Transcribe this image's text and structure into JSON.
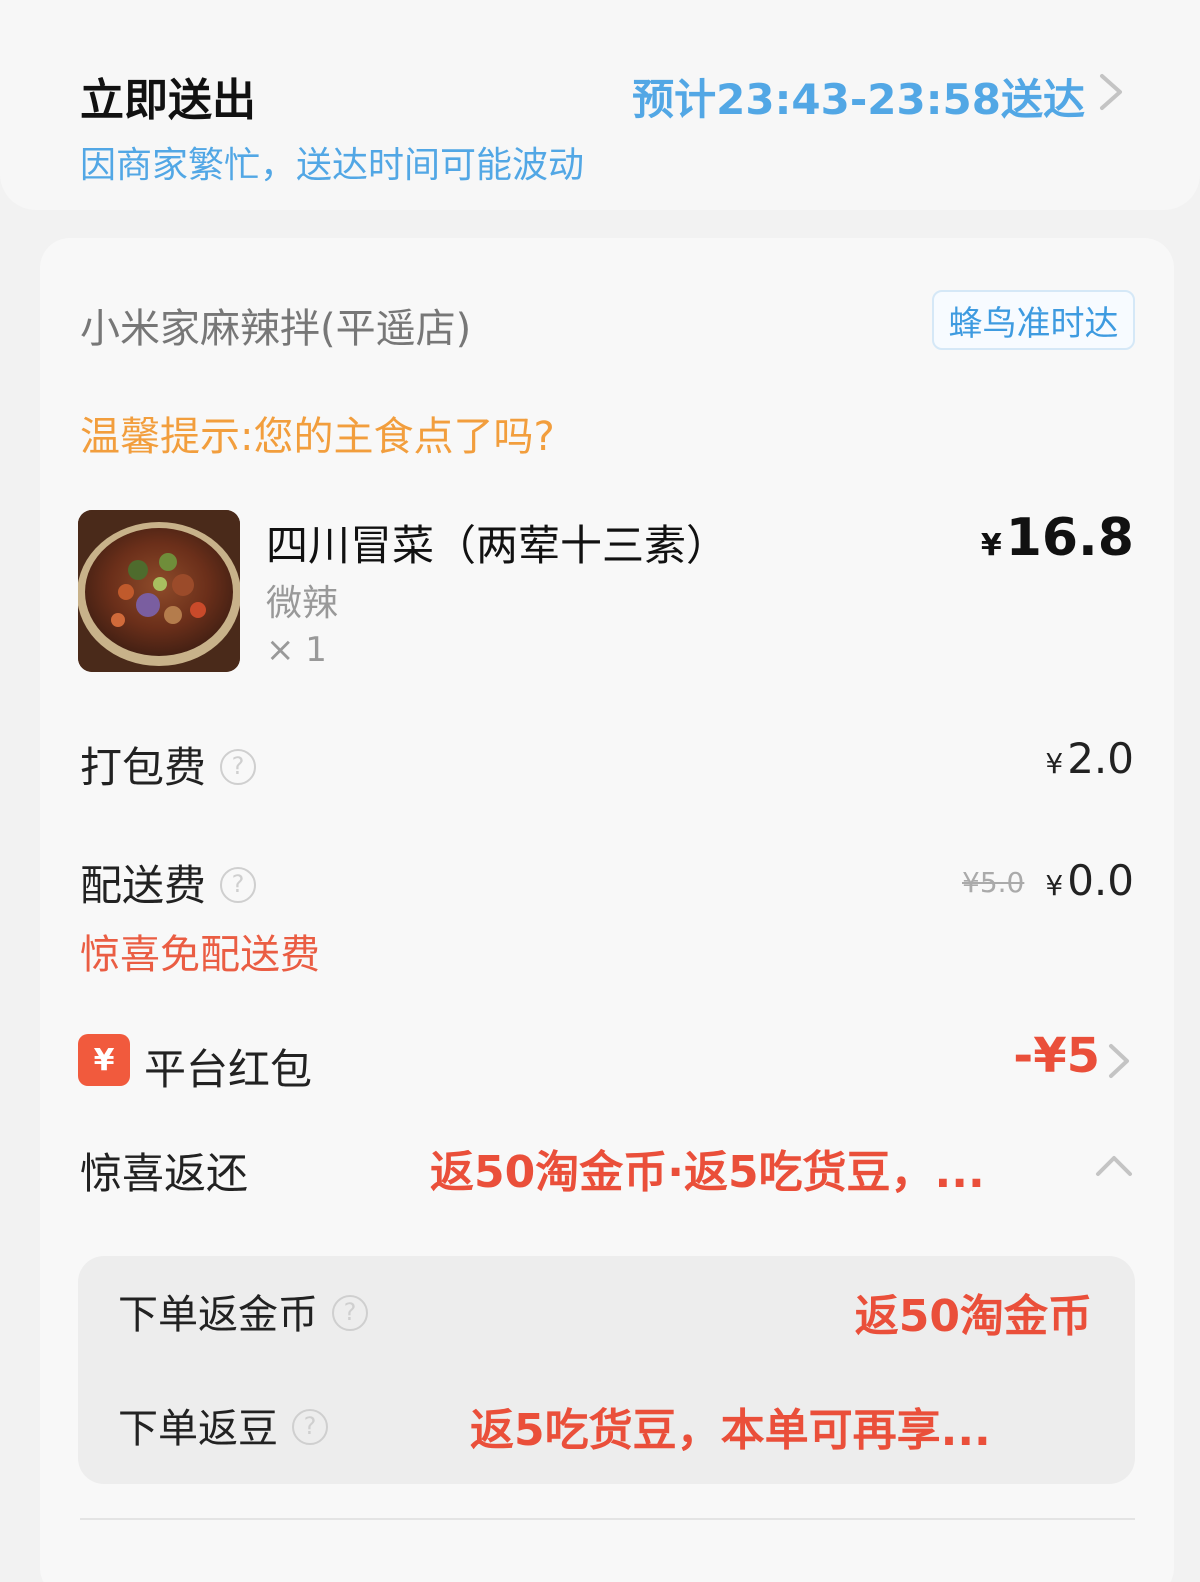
{
  "delivery": {
    "title": "立即送出",
    "eta": "预计23:43-23:58送达",
    "note": "因商家繁忙，送达时间可能波动"
  },
  "store": {
    "name": "小米家麻辣拌(平遥店)",
    "badge": "蜂鸟准时达",
    "tip": "温馨提示:您的主食点了吗?"
  },
  "item": {
    "name": "四川冒菜（两荤十三素）",
    "spec": "微辣",
    "qty": "× 1",
    "currency": "¥",
    "price": "16.8"
  },
  "fees": {
    "packing_label": "打包费",
    "packing_currency": "¥",
    "packing_value": "2.0",
    "delivery_label": "配送费",
    "delivery_original": "¥5.0",
    "delivery_currency": "¥",
    "delivery_value": "0.0",
    "delivery_note": "惊喜免配送费"
  },
  "redpacket": {
    "icon": "¥",
    "label": "平台红包",
    "value": "-¥5"
  },
  "rebate": {
    "label": "惊喜返还",
    "summary": "返50淘金币·返5吃货豆，...",
    "items": [
      {
        "label": "下单返金币",
        "value": "返50淘金币"
      },
      {
        "label": "下单返豆",
        "value": "返5吃货豆，本单可再享..."
      }
    ]
  },
  "colors": {
    "accent_blue": "#52a7e5",
    "tip_orange": "#f29e3d",
    "promo_red": "#ea4f3a"
  }
}
